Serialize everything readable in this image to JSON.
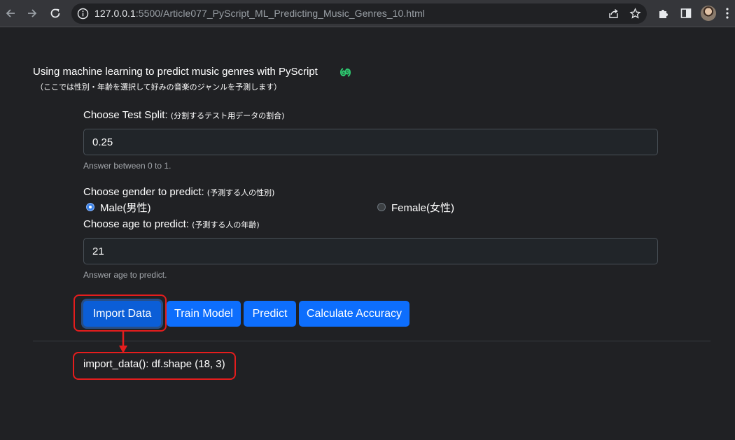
{
  "browser": {
    "url_host": "127.0.0.1",
    "url_rest": ":5500/Article077_PyScript_ML_Predicting_Music_Genres_10.html",
    "icons": [
      "back-icon",
      "forward-icon",
      "reload-icon",
      "info-icon",
      "share-icon",
      "bookmark-star-icon",
      "extensions-icon",
      "side-panel-icon",
      "profile-avatar",
      "menu-icon"
    ]
  },
  "page": {
    "title": "Using machine learning to predict music genres with PyScript",
    "subtitle": "（ここでは性別・年齢を選択して好みの音楽のジャンルを予測します）"
  },
  "form": {
    "test_split": {
      "label": "Choose Test Split:",
      "label_note": "(分割するテスト用データの割合)",
      "value": "0.25",
      "help": "Answer between 0 to 1."
    },
    "gender": {
      "label": "Choose gender to predict:",
      "label_note": "(予測する人の性別)",
      "options": [
        {
          "label": "Male(男性)",
          "checked": true
        },
        {
          "label": "Female(女性)",
          "checked": false
        }
      ]
    },
    "age": {
      "label": "Choose age to predict:",
      "label_note": "(予測する人の年齢)",
      "value": "21",
      "help": "Answer age to predict."
    }
  },
  "buttons": {
    "import": "Import Data",
    "train": "Train Model",
    "predict": "Predict",
    "accuracy": "Calculate Accuracy"
  },
  "output": {
    "text": "import_data(): df.shape (18, 3)"
  },
  "colors": {
    "button": "#0d6efd",
    "annotation": "#e51d1d",
    "pyscript_logo": "#2ecc71"
  }
}
